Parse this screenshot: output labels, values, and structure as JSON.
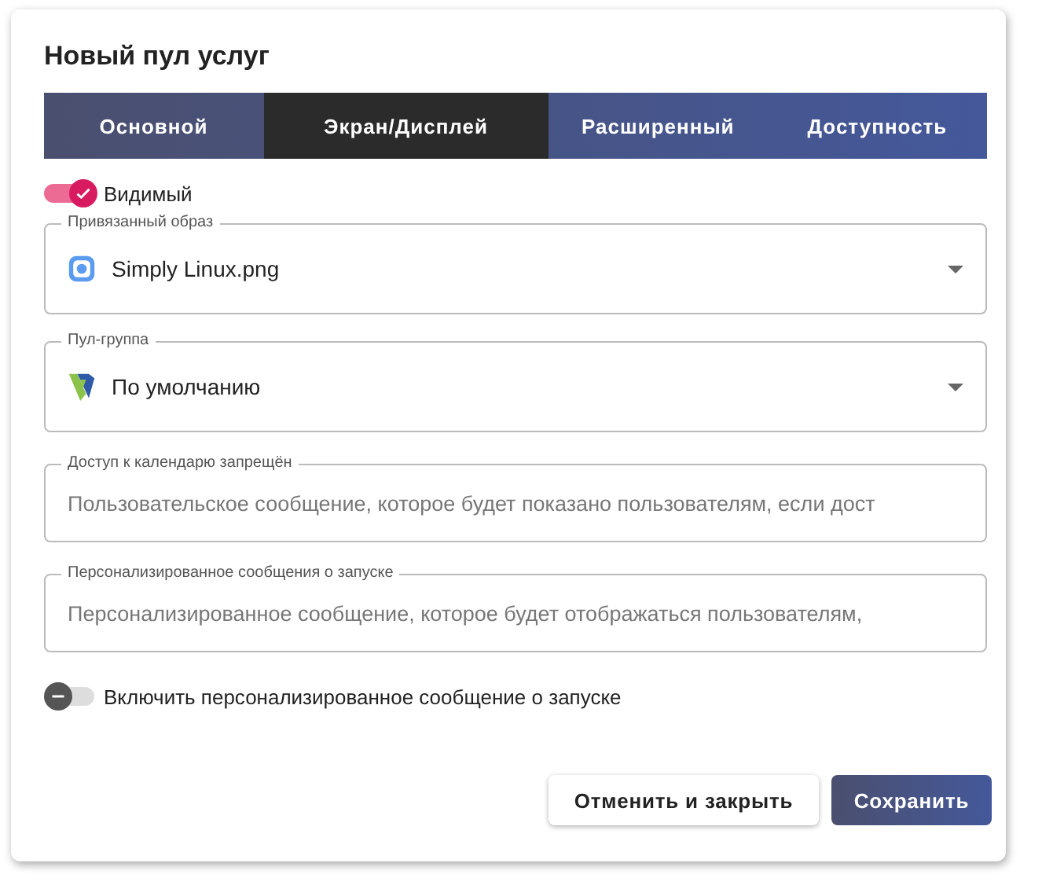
{
  "dialog": {
    "title": "Новый пул услуг"
  },
  "tabs": [
    {
      "label": "Основной",
      "selected": false
    },
    {
      "label": "Экран/Дисплей",
      "selected": true
    },
    {
      "label": "Расширенный",
      "selected": false
    },
    {
      "label": "Доступность",
      "selected": false
    }
  ],
  "visible_toggle": {
    "label": "Видимый",
    "on": true
  },
  "fields": [
    {
      "kind": "select",
      "label": "Привязанный образ",
      "value": "Simply Linux.png"
    },
    {
      "kind": "select",
      "label": "Пул-группа",
      "value": "По умолчанию"
    },
    {
      "kind": "text",
      "label": "Доступ к календарю запрещён",
      "placeholder": "Пользовательское сообщение, которое будет показано пользователям, если дост"
    },
    {
      "kind": "text",
      "label": "Персонализированное сообщения о запуске",
      "placeholder": "Персонализированное сообщение, которое будет отображаться пользователям,"
    }
  ],
  "custom_message_toggle": {
    "label": "Включить персонализированное сообщение о запуске",
    "on": false
  },
  "buttons": [
    {
      "label": "Отменить и закрыть",
      "kind": "secondary"
    },
    {
      "label": "Сохранить",
      "kind": "primary"
    }
  ]
}
